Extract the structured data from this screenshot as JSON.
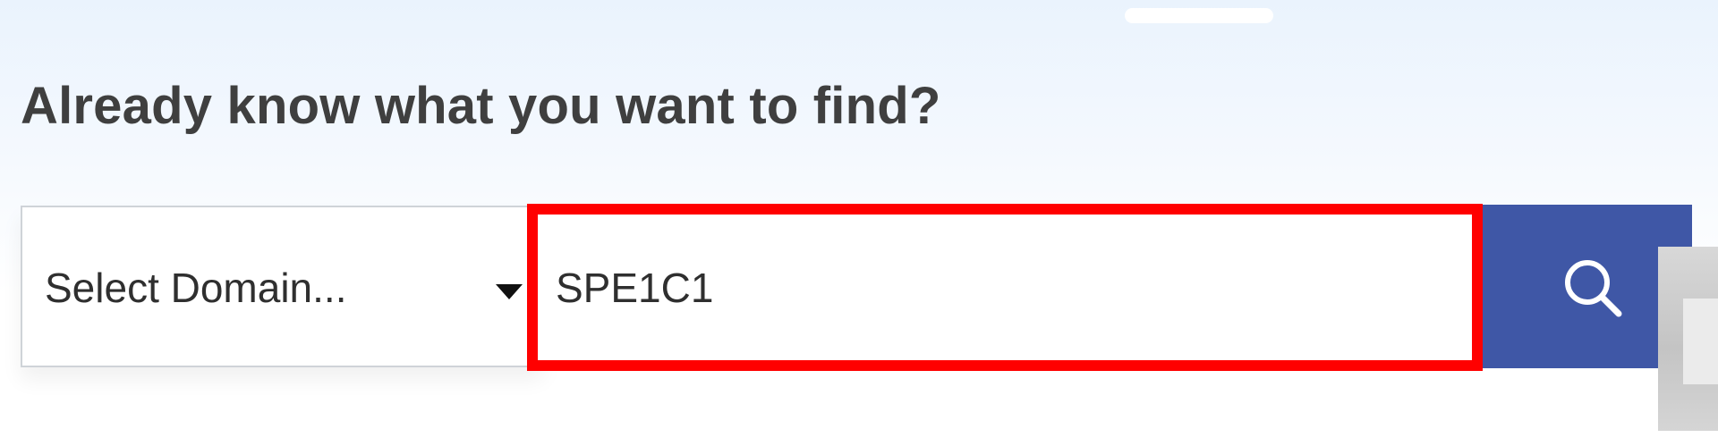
{
  "page": {
    "heading": "Already know what you want to find?"
  },
  "search": {
    "domain_select": {
      "selected_label": "Select Domain..."
    },
    "query_input": {
      "value": "SPE1C1"
    },
    "submit": {
      "icon": "search-icon"
    }
  },
  "colors": {
    "heading_text": "#3f3f3f",
    "search_button": "#3f57a6",
    "highlight_outline": "#ff0000",
    "field_border": "#cfd3d8"
  }
}
